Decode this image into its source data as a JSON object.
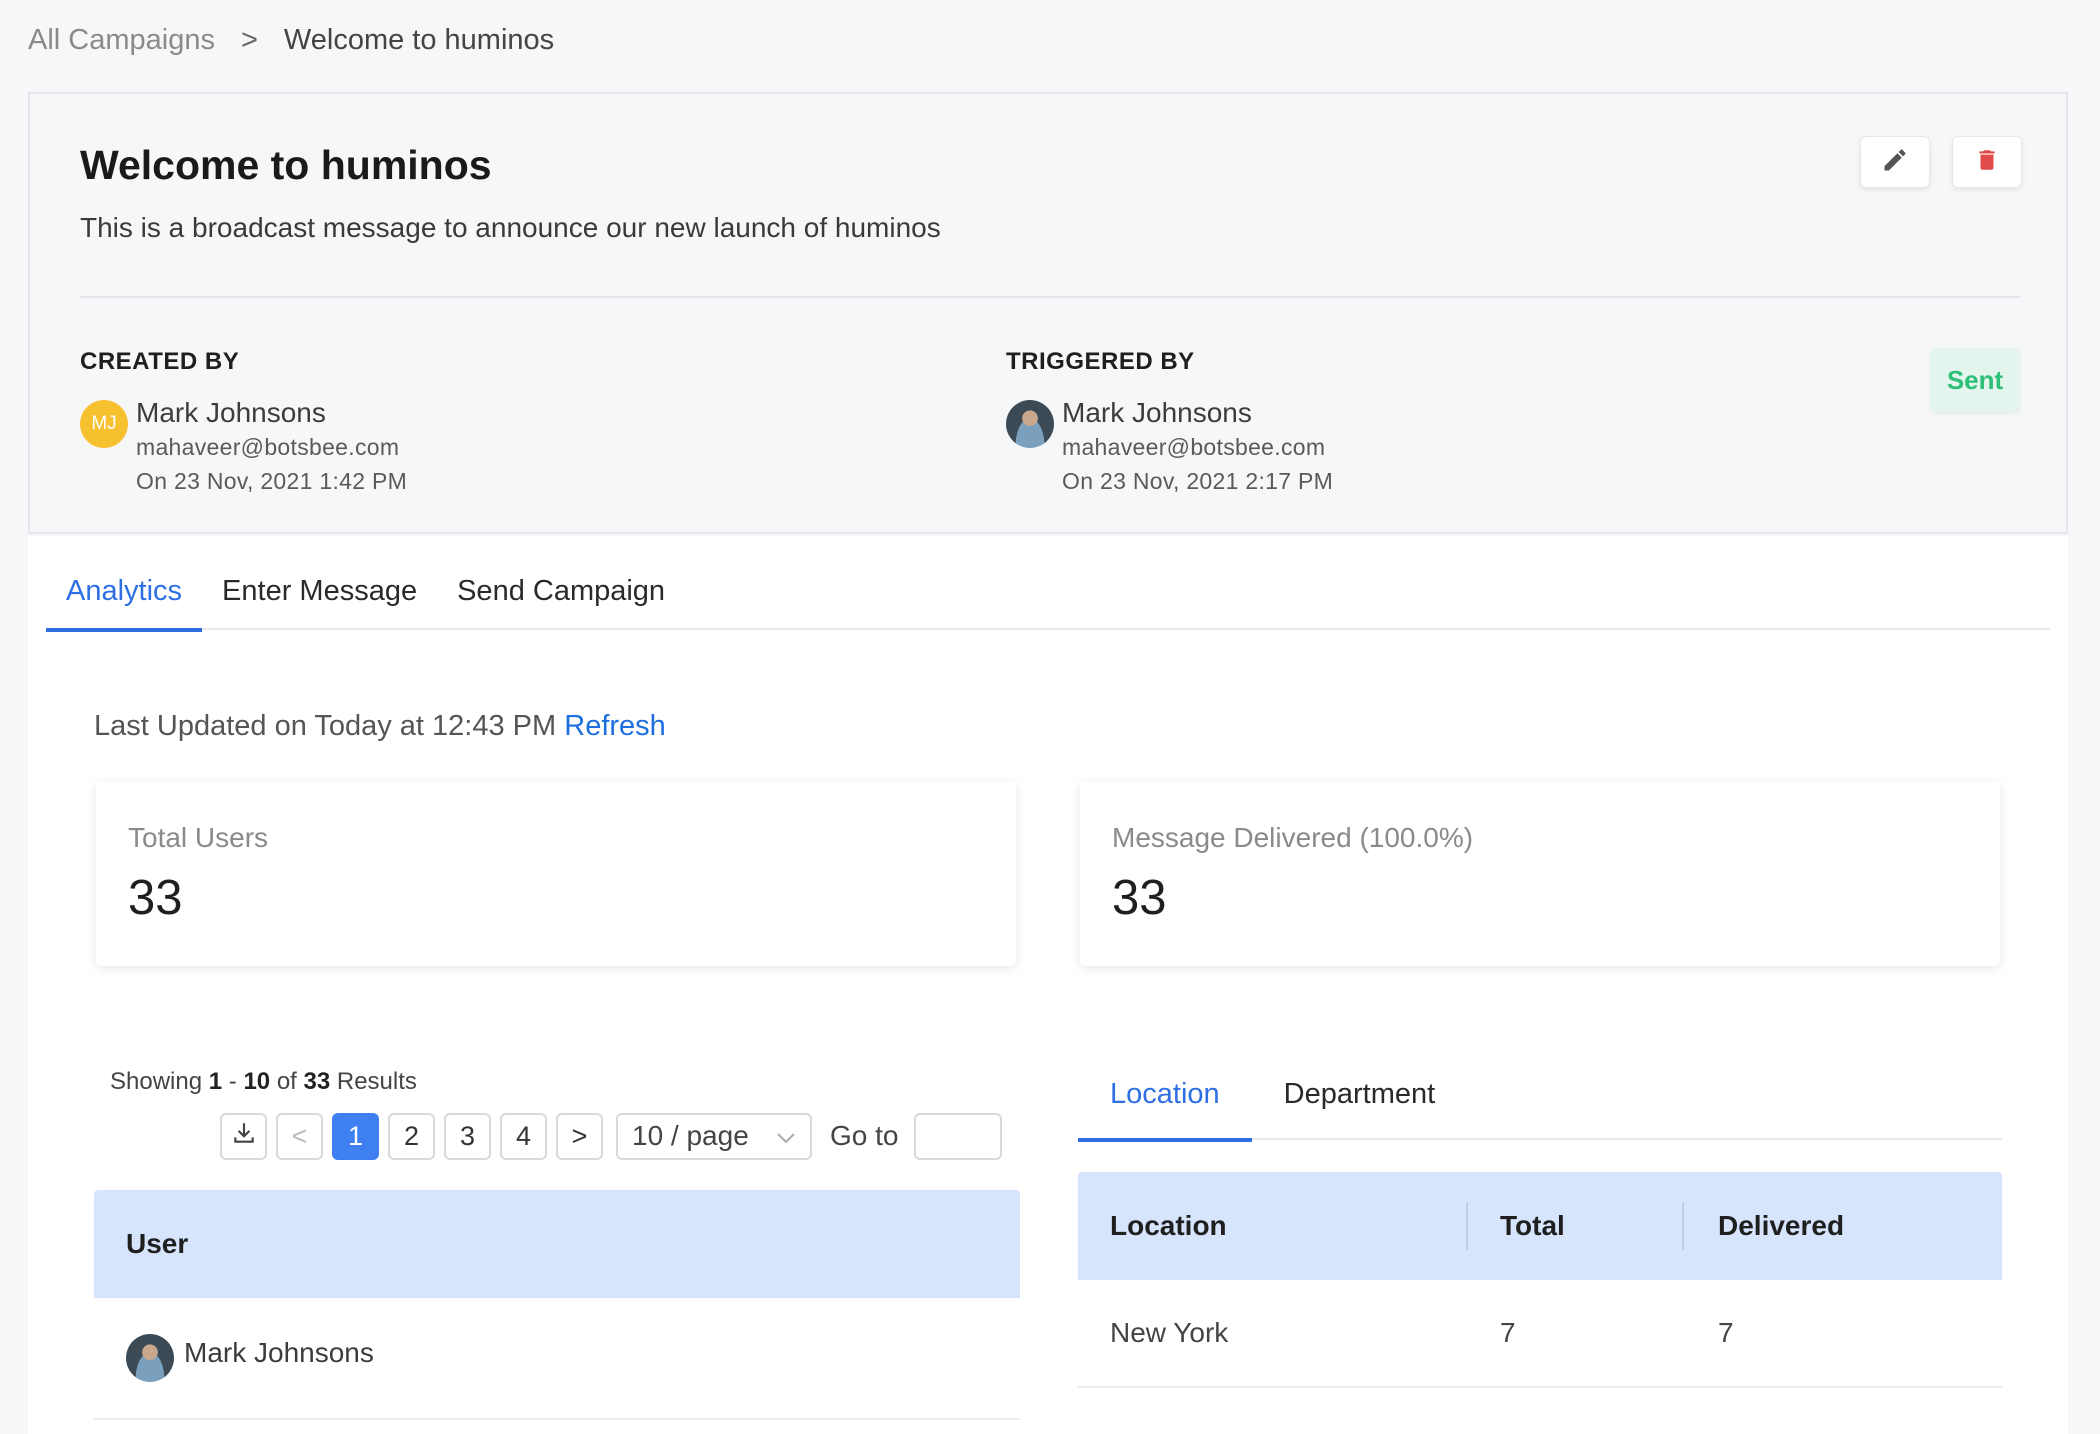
{
  "breadcrumb": {
    "root": "All Campaigns",
    "separator": ">",
    "current": "Welcome to huminos"
  },
  "campaign": {
    "title": "Welcome to huminos",
    "description": "This is a broadcast message to announce our new launch of huminos",
    "status": "Sent",
    "status_color": "#2ebf78"
  },
  "created_by": {
    "label": "CREATED BY",
    "initials": "MJ",
    "name": "Mark Johnsons",
    "email": "mahaveer@botsbee.com",
    "date": "On 23 Nov, 2021 1:42 PM"
  },
  "triggered_by": {
    "label": "TRIGGERED BY",
    "name": "Mark Johnsons",
    "email": "mahaveer@botsbee.com",
    "date": "On 23 Nov, 2021 2:17 PM"
  },
  "tabs": [
    {
      "label": "Analytics",
      "active": true
    },
    {
      "label": "Enter Message",
      "active": false
    },
    {
      "label": "Send Campaign",
      "active": false
    }
  ],
  "analytics": {
    "last_updated": "Last Updated on Today at 12:43 PM",
    "refresh_label": "Refresh",
    "total_users_label": "Total Users",
    "total_users_value": "33",
    "delivered_label": "Message Delivered (100.0%)",
    "delivered_value": "33"
  },
  "results": {
    "prefix": "Showing",
    "from": "1",
    "dash": "-",
    "to": "10",
    "of": "of",
    "total": "33",
    "suffix": "Results"
  },
  "pagination": {
    "prev_symbol": "<",
    "next_symbol": ">",
    "pages": [
      "1",
      "2",
      "3",
      "4"
    ],
    "current_page": "1",
    "page_size": "10 / page",
    "goto_label": "Go to",
    "goto_value": ""
  },
  "users_table": {
    "header": "User",
    "rows": [
      {
        "name": "Mark Johnsons"
      }
    ]
  },
  "breakdown_tabs": [
    {
      "label": "Location",
      "active": true
    },
    {
      "label": "Department",
      "active": false
    }
  ],
  "location_table": {
    "headers": [
      "Location",
      "Total",
      "Delivered"
    ],
    "rows": [
      {
        "location": "New York",
        "total": "7",
        "delivered": "7"
      }
    ]
  },
  "colors": {
    "accent": "#2f6fe4",
    "table_header_bg": "#d6e5fc",
    "delete": "#e04a4a",
    "avatar_initials_bg": "#f6c02f"
  },
  "icons": {
    "edit": "pencil-icon",
    "delete": "trash-icon",
    "download": "download-icon",
    "dropdown": "chevron-down-icon"
  }
}
